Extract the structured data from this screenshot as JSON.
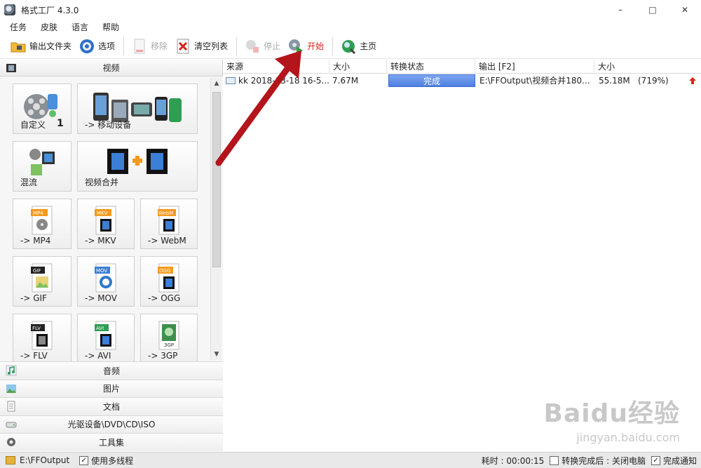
{
  "window": {
    "title": "格式工厂 4.3.0",
    "minimize": "–",
    "maximize": "□",
    "close": "✕"
  },
  "menu": [
    "任务",
    "皮肤",
    "语言",
    "帮助"
  ],
  "toolbar": {
    "output_folder": "输出文件夹",
    "options": "选项",
    "remove": "移除",
    "clear_list": "清空列表",
    "stop": "停止",
    "start": "开始",
    "home": "主页"
  },
  "left_panel": {
    "video_header": "视频",
    "tiles": [
      {
        "label": "自定义",
        "badge": "1"
      },
      {
        "label": "-> 移动设备"
      },
      {
        "label": "混流"
      },
      {
        "label": "视频合并"
      },
      {
        "label": "-> MP4",
        "tag": "MP4"
      },
      {
        "label": "-> MKV",
        "tag": "MKV"
      },
      {
        "label": "-> WebM",
        "tag": "WebM"
      },
      {
        "label": "-> GIF",
        "tag": "GIF"
      },
      {
        "label": "-> MOV",
        "tag": "MOV"
      },
      {
        "label": "-> OGG",
        "tag": "OGG"
      },
      {
        "label": "-> FLV",
        "tag": "FLV"
      },
      {
        "label": "-> AVI",
        "tag": "AVI"
      },
      {
        "label": "-> 3GP",
        "tag": "3GP"
      }
    ],
    "categories": [
      "音频",
      "图片",
      "文档",
      "光驱设备\\DVD\\CD\\ISO",
      "工具集"
    ]
  },
  "table": {
    "headers": [
      "来源",
      "大小",
      "转换状态",
      "输出 [F2]",
      "大小"
    ],
    "rows": [
      {
        "source": "kk 2018-03-18 16-5...",
        "size": "7.67M",
        "status": "完成",
        "output": "E:\\FFOutput\\视频合并180...",
        "out_size": "55.18M",
        "ratio": "(719%)"
      }
    ]
  },
  "statusbar": {
    "path": "E:\\FFOutput",
    "multithread": "使用多线程",
    "elapsed": "耗时 : 00:00:15",
    "after_done": "转换完成后 : 关闭电脑",
    "notify": "完成通知"
  },
  "watermark": {
    "main": "Baidu经验",
    "sub": "jingyan.baidu.com"
  },
  "colors": {
    "status_fill": "#5a8ae6",
    "start_text": "#d0261f",
    "arrow": "#b3151b"
  }
}
